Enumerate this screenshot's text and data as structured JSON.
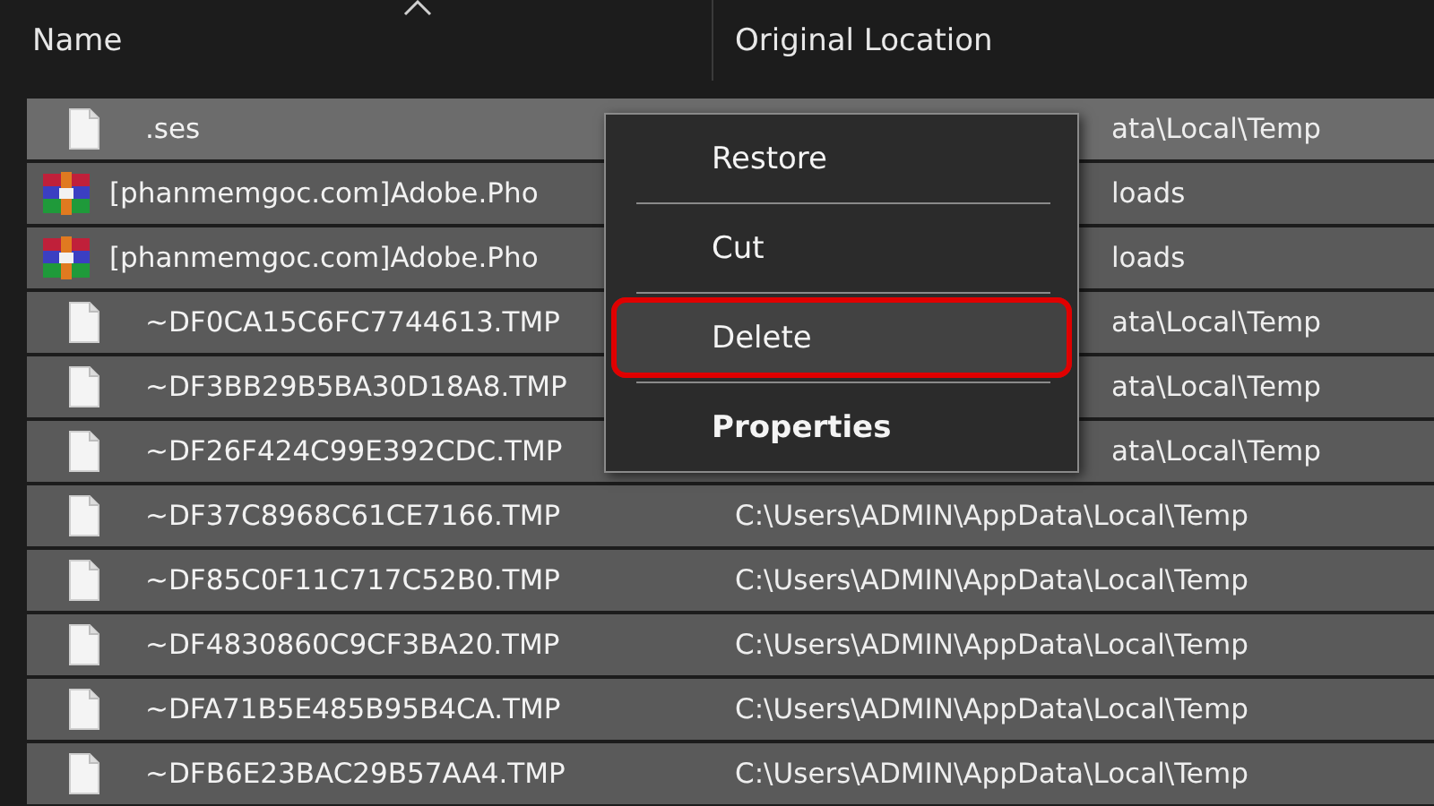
{
  "header": {
    "columns": [
      {
        "label": "Name",
        "sorted": true
      },
      {
        "label": "Original Location",
        "sorted": false
      }
    ]
  },
  "rows": [
    {
      "name": ".ses",
      "location": "ata\\Local\\Temp",
      "kind": "file",
      "focused": true,
      "covered": true
    },
    {
      "name": "[phanmemgoc.com]Adobe.Pho",
      "location": "loads",
      "kind": "archive",
      "focused": false,
      "covered": true
    },
    {
      "name": "[phanmemgoc.com]Adobe.Pho",
      "location": "loads",
      "kind": "archive",
      "focused": false,
      "covered": true
    },
    {
      "name": "~DF0CA15C6FC7744613.TMP",
      "location": "ata\\Local\\Temp",
      "kind": "file",
      "focused": false,
      "covered": true
    },
    {
      "name": "~DF3BB29B5BA30D18A8.TMP",
      "location": "ata\\Local\\Temp",
      "kind": "file",
      "focused": false,
      "covered": true
    },
    {
      "name": "~DF26F424C99E392CDC.TMP",
      "location": "ata\\Local\\Temp",
      "kind": "file",
      "focused": false,
      "covered": true
    },
    {
      "name": "~DF37C8968C61CE7166.TMP",
      "location": "C:\\Users\\ADMIN\\AppData\\Local\\Temp",
      "kind": "file",
      "focused": false,
      "covered": false
    },
    {
      "name": "~DF85C0F11C717C52B0.TMP",
      "location": "C:\\Users\\ADMIN\\AppData\\Local\\Temp",
      "kind": "file",
      "focused": false,
      "covered": false
    },
    {
      "name": "~DF4830860C9CF3BA20.TMP",
      "location": "C:\\Users\\ADMIN\\AppData\\Local\\Temp",
      "kind": "file",
      "focused": false,
      "covered": false
    },
    {
      "name": "~DFA71B5E485B95B4CA.TMP",
      "location": "C:\\Users\\ADMIN\\AppData\\Local\\Temp",
      "kind": "file",
      "focused": false,
      "covered": false
    },
    {
      "name": "~DFB6E23BAC29B57AA4.TMP",
      "location": "C:\\Users\\ADMIN\\AppData\\Local\\Temp",
      "kind": "file",
      "focused": false,
      "covered": false
    }
  ],
  "context_menu": {
    "items": [
      {
        "label": "Restore",
        "highlighted": false,
        "bold": false
      },
      {
        "label": "Cut",
        "highlighted": false,
        "bold": false
      },
      {
        "label": "Delete",
        "highlighted": true,
        "bold": false
      },
      {
        "label": "Properties",
        "highlighted": false,
        "bold": true
      }
    ]
  }
}
